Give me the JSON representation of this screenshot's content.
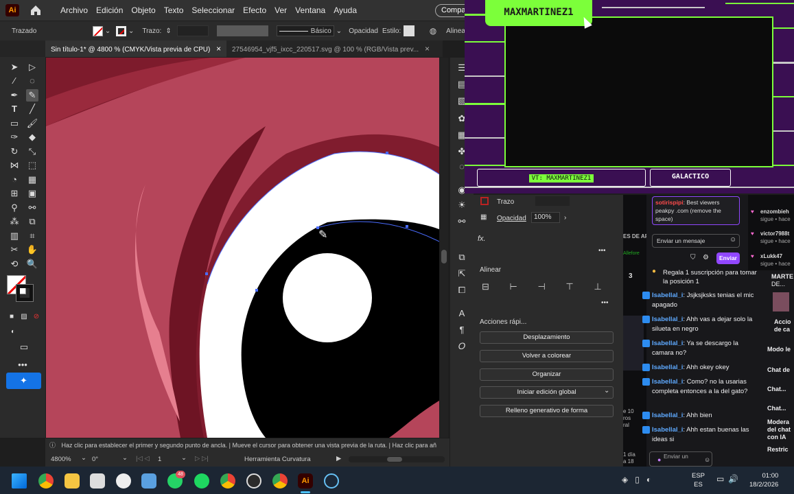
{
  "app": {
    "logo": "Ai",
    "share_label": "Compar"
  },
  "menu": [
    "Archivo",
    "Edición",
    "Objeto",
    "Texto",
    "Seleccionar",
    "Efecto",
    "Ver",
    "Ventana",
    "Ayuda"
  ],
  "control": {
    "mode": "Trazado",
    "stroke_label": "Trazo:",
    "brush": "Básico",
    "opacity": "Opacidad",
    "style": "Estilo:",
    "align": "Alinea"
  },
  "tabs": [
    {
      "label": "Sin título-1* @ 4800 % (CMYK/Vista previa de CPU)",
      "close": "×"
    },
    {
      "label": "27546954_vjf5_ixcc_220517.svg @ 100 % (RGB/Vista prev...",
      "close": "×"
    }
  ],
  "status": {
    "hint": "Haz clic para establecer el primer y segundo punto de ancla.  |  Mueve el cursor para obtener una vista previa de la ruta.  |  Haz clic para añ",
    "zoom": "4800%",
    "angle": "0°",
    "artboard": "1",
    "tool": "Herramienta Curvatura"
  },
  "properties": {
    "stroke": "Trazo",
    "opacity_label": "Opacidad",
    "opacity_value": "100%",
    "fx": "fx.",
    "align_title": "Alinear",
    "quick_actions": "Acciones rápi...",
    "buttons": [
      "Desplazamiento",
      "Volver a colorear",
      "Organizar",
      "Iniciar edición global",
      "Relleno generativo de forma"
    ]
  },
  "overlay": {
    "streamer": "MAXMARTINEZ1",
    "vt": "VT: MAXMARTINEZ1",
    "game": "GALACTICO"
  },
  "chat": {
    "pinned_user": "sotirispipi",
    "pinned_text": ": Best viewers peakpy .com (remove the space)",
    "input_placeholder": "Enviar un mensaje",
    "send": "Enviar",
    "gift_text": "Regala 1 suscripción para tomar la posición 1",
    "gift_num": "3",
    "messages": [
      {
        "user": "Isabellal_i",
        "text": ": Jsjksjksks tenias el mic apagado"
      },
      {
        "user": "Isabellal_i",
        "text": ": Ahh vas a dejar solo la silueta en negro"
      },
      {
        "user": "Isabellal_i",
        "text": ": Ya se descargo la camara no?"
      },
      {
        "user": "Isabellal_i",
        "text": ": Ahh okey okey"
      },
      {
        "user": "Isabellal_i",
        "text": ": Como? no la usarias completa entonces a la del gato?"
      },
      {
        "user": "Isabellal_i",
        "text": ": Ahh bien"
      },
      {
        "user": "Isabellal_i",
        "text": ": Ahh estan buenas las ideas si"
      }
    ],
    "followers": [
      {
        "user": "enzombieh",
        "text": "sigue • hace"
      },
      {
        "user": "victor7988t",
        "text": "sigue • hace"
      },
      {
        "user": "xLukk47",
        "text": "sigue • hace"
      }
    ],
    "side": [
      "Accio de ca",
      "Modo le",
      "Chat de",
      "Chat...",
      "Chat...",
      "Modera del chat con IA",
      "Restric"
    ],
    "side_top": "MARTE",
    "side_top2": "DE...",
    "bottom_input": "Enviar un"
  },
  "left_peek": [
    "ES DE API",
    "Allefore",
    "e 10",
    "ros",
    "ral",
    "1 día",
    "a 18"
  ],
  "taskbar": {
    "lang1": "ESP",
    "lang2": "ES",
    "time": "01:00",
    "date": "18/2/2026",
    "whatsapp_badge": "48"
  }
}
